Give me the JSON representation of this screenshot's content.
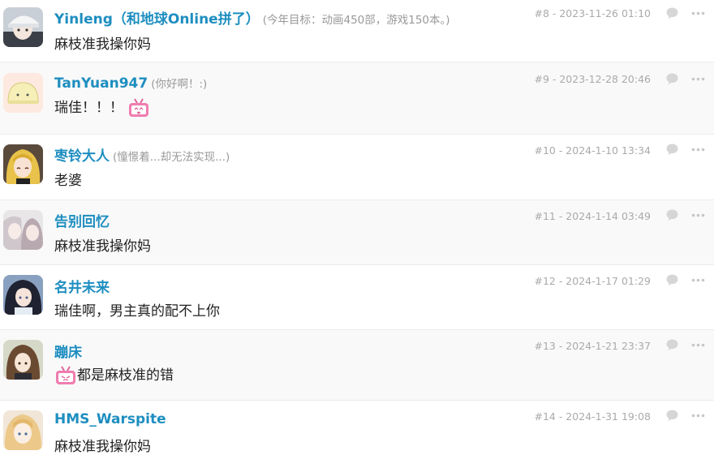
{
  "comments": [
    {
      "user": "Yinleng（和地球Online拼了）",
      "sign": "(今年目标：动画450部，游戏150本。)",
      "text": "麻枝准我操你妈",
      "meta": "#8 - 2023-11-26 01:10",
      "avatar": "avatar-white-cap-boy"
    },
    {
      "user": "TanYuan947",
      "sign": "(你好啊！:)",
      "text": "瑞佳！！！",
      "meta": "#9 - 2023-12-28 20:46",
      "avatar": "avatar-yellow-blob",
      "emoji": "tv-emoticon-icon"
    },
    {
      "user": "枣铃大人",
      "sign": "(憧憬着...却无法实现...)",
      "text": "老婆",
      "meta": "#10 - 2024-1-10 13:34",
      "avatar": "avatar-blonde-girl"
    },
    {
      "user": "告别回忆",
      "sign": "",
      "text": "麻枝准我操你妈",
      "meta": "#11 - 2024-1-14 03:49",
      "avatar": "avatar-pale-couple"
    },
    {
      "user": "名井未来",
      "sign": "",
      "text": "瑞佳啊，男主真的配不上你",
      "meta": "#12 - 2024-1-17 01:29",
      "avatar": "avatar-dark-hair-girl"
    },
    {
      "user": "蹦床",
      "sign": "",
      "text": "都是麻枝准的错",
      "meta": "#13 - 2024-1-21 23:37",
      "avatar": "avatar-brown-hair-girl",
      "emoji": "tv-emoticon-icon"
    },
    {
      "user": "HMS_Warspite",
      "sign": "",
      "text": "麻枝准我操你妈",
      "meta": "#14 - 2024-1-31 19:08",
      "avatar": "avatar-blonde-anime-girl"
    }
  ],
  "colors": {
    "username": "#1e8ec0",
    "meta": "#aaaaaa",
    "sign": "#999999",
    "alt_row": "#f9f9f9"
  },
  "icons": {
    "reply": "speech-bubble-icon",
    "more": "ellipsis-icon"
  }
}
